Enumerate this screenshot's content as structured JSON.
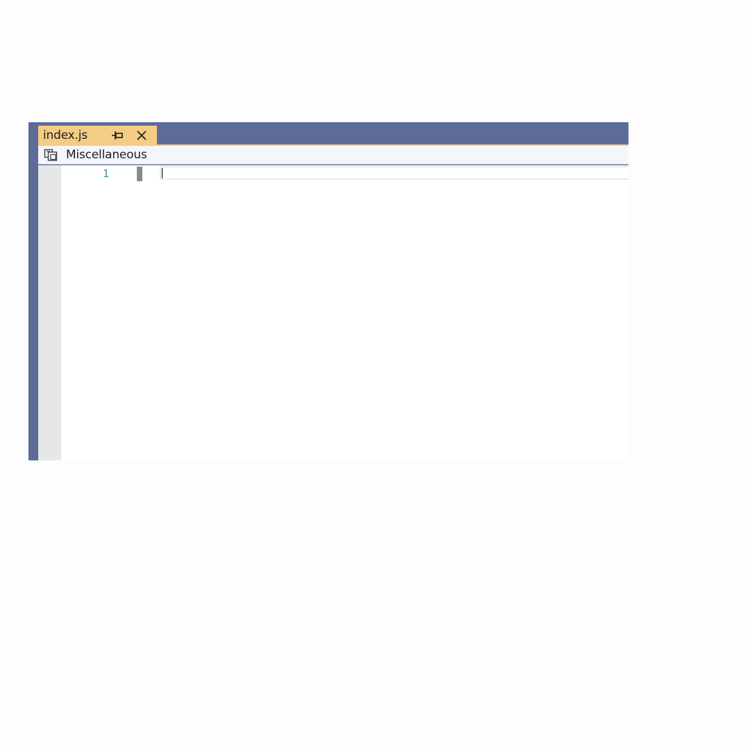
{
  "tab": {
    "filename": "index.js",
    "pin_icon": "pin-icon",
    "close_icon": "close-icon",
    "active_color": "#f5cc84"
  },
  "nav_bar": {
    "project_icon": "miscellaneous-files-icon",
    "project_label": "Miscellaneous"
  },
  "editor": {
    "lines": [
      {
        "number": "1",
        "text": ""
      }
    ],
    "line_number_color": "#2b91af",
    "change_marker_color": "#878c8b"
  },
  "theme": {
    "frame_color": "#5d6b99",
    "margin_color": "#e6e7e8",
    "background": "#ffffff"
  }
}
